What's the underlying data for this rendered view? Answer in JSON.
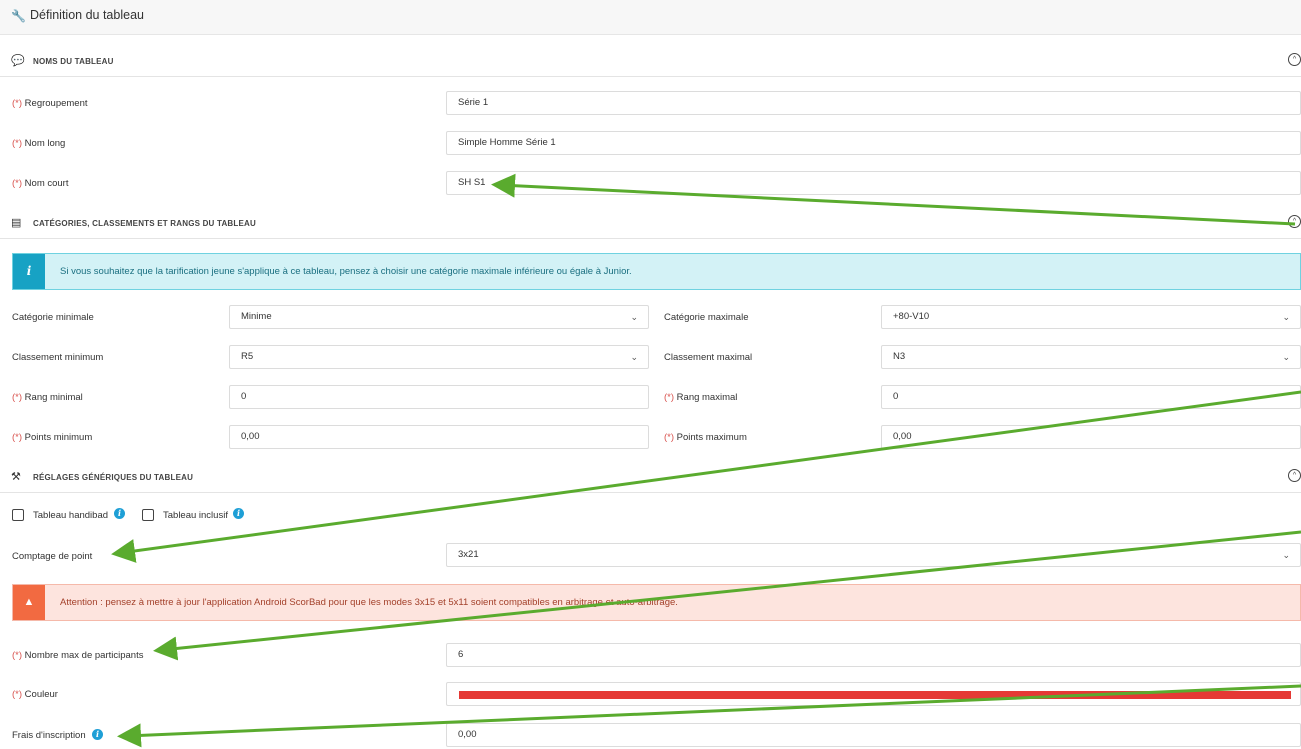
{
  "header": {
    "title": "Définition du tableau",
    "icon": "wrench-icon"
  },
  "sections": {
    "noms": {
      "title": "NOMS DU TABLEAU",
      "icon": "comment-icon"
    },
    "categories": {
      "title": "CATÉGORIES, CLASSEMENTS ET RANGS DU TABLEAU",
      "icon": "list-icon"
    },
    "reglages": {
      "title": "RÉGLAGES GÉNÉRIQUES DU TABLEAU",
      "icon": "hammer-icon"
    }
  },
  "required_mark": "(*)",
  "fields": {
    "regroupement": {
      "label": "Regroupement",
      "value": "Série 1"
    },
    "nom_long": {
      "label": "Nom long",
      "value": "Simple Homme Série 1"
    },
    "nom_court": {
      "label": "Nom court",
      "value": "SH S1"
    },
    "categorie_min": {
      "label": "Catégorie minimale",
      "value": "Minime"
    },
    "categorie_max": {
      "label": "Catégorie maximale",
      "value": "+80-V10"
    },
    "classement_min": {
      "label": "Classement minimum",
      "value": "R5"
    },
    "classement_max": {
      "label": "Classement maximal",
      "value": "N3"
    },
    "rang_min": {
      "label": "Rang minimal",
      "value": "0"
    },
    "rang_max": {
      "label": "Rang maximal",
      "value": "0"
    },
    "points_min": {
      "label": "Points minimum",
      "value": "0,00"
    },
    "points_max": {
      "label": "Points maximum",
      "value": "0,00"
    },
    "comptage": {
      "label": "Comptage de point",
      "value": "3x21"
    },
    "nb_max": {
      "label": "Nombre max de participants",
      "value": "6"
    },
    "couleur": {
      "label": "Couleur",
      "value": "#e53935"
    },
    "frais": {
      "label": "Frais d'inscription",
      "value": "0,00"
    }
  },
  "checkboxes": {
    "handibad": {
      "label": "Tableau handibad",
      "checked": false
    },
    "inclusif": {
      "label": "Tableau inclusif",
      "checked": false
    }
  },
  "alerts": {
    "info": "Si vous souhaitez que la tarification jeune s'applique à ce tableau, pensez à choisir une catégorie maximale inférieure ou égale à Junior.",
    "warning": "Attention : pensez à mettre à jour l'application Android ScorBad pour que les modes 3x15 et 5x11 soient compatibles en arbitrage et auto-arbitrage."
  },
  "colors": {
    "annotation_arrow": "#5aab2e",
    "required": "#d9534f",
    "info_accent": "#17a2c4",
    "warning_accent": "#f26a41"
  }
}
